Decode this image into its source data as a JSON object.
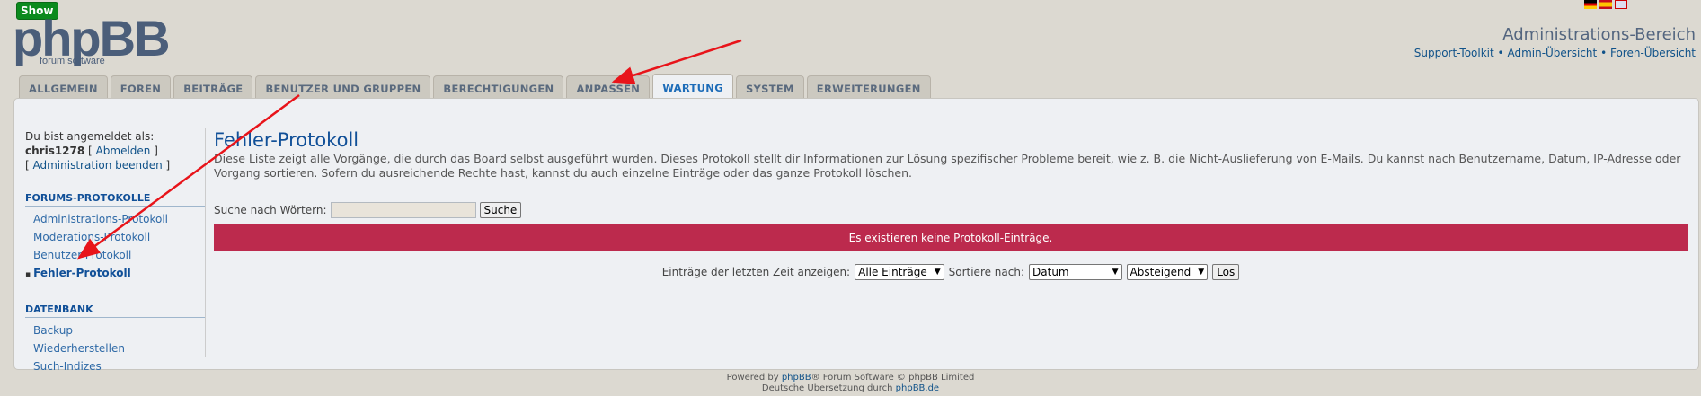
{
  "overlay": {
    "show_label": "Show"
  },
  "logo": {
    "main": "phpBB",
    "sub": "forum software"
  },
  "header": {
    "title": "Administrations-Bereich",
    "links": [
      "Support-Toolkit",
      "Admin-Übersicht",
      "Foren-Übersicht"
    ],
    "separator": "•"
  },
  "tabs": [
    {
      "label": "ALLGEMEIN"
    },
    {
      "label": "FOREN"
    },
    {
      "label": "BEITRÄGE"
    },
    {
      "label": "BENUTZER UND GRUPPEN"
    },
    {
      "label": "BERECHTIGUNGEN"
    },
    {
      "label": "ANPASSEN"
    },
    {
      "label": "WARTUNG",
      "active": true
    },
    {
      "label": "SYSTEM"
    },
    {
      "label": "ERWEITERUNGEN"
    }
  ],
  "sidebar": {
    "logged_in_text": "Du bist angemeldet als:",
    "username": "chris1278",
    "logout": "Abmelden",
    "end_admin": "Administration beenden",
    "sections": [
      {
        "title": "FORUMS-PROTOKOLLE",
        "items": [
          {
            "label": "Administrations-Protokoll"
          },
          {
            "label": "Moderations-Protokoll"
          },
          {
            "label": "Benutzer-Protokoll"
          },
          {
            "label": "Fehler-Protokoll",
            "active": true
          }
        ]
      },
      {
        "title": "DATENBANK",
        "items": [
          {
            "label": "Backup"
          },
          {
            "label": "Wiederherstellen"
          },
          {
            "label": "Such-Indizes"
          }
        ]
      }
    ]
  },
  "main": {
    "title": "Fehler-Protokoll",
    "description": "Diese Liste zeigt alle Vorgänge, die durch das Board selbst ausgeführt wurden. Dieses Protokoll stellt dir Informationen zur Lösung spezifischer Probleme bereit, wie z. B. die Nicht-Auslieferung von E-Mails. Du kannst nach Benutzername, Datum, IP-Adresse oder Vorgang sortieren. Sofern du ausreichende Rechte hast, kannst du auch einzelne Einträge oder das ganze Protokoll löschen.",
    "search_label": "Suche nach Wörtern:",
    "search_value": "",
    "search_button": "Suche",
    "no_entries": "Es existieren keine Protokoll-Einträge.",
    "filter_label": "Einträge der letzten Zeit anzeigen:",
    "filter_value": "Alle Einträge",
    "sort_label": "Sortiere nach:",
    "sort_value": "Datum",
    "order_value": "Absteigend",
    "go_button": "Los"
  },
  "footer": {
    "line1_prefix": "Powered by",
    "line1_link": "phpBB",
    "line1_suffix": "® Forum Software © phpBB Limited",
    "line2_prefix": "Deutsche Übersetzung durch",
    "line2_link": "phpBB.de"
  },
  "colors": {
    "accent": "#115098",
    "error_bar": "#bc2a4d",
    "annotation_arrow": "#e8141a"
  }
}
